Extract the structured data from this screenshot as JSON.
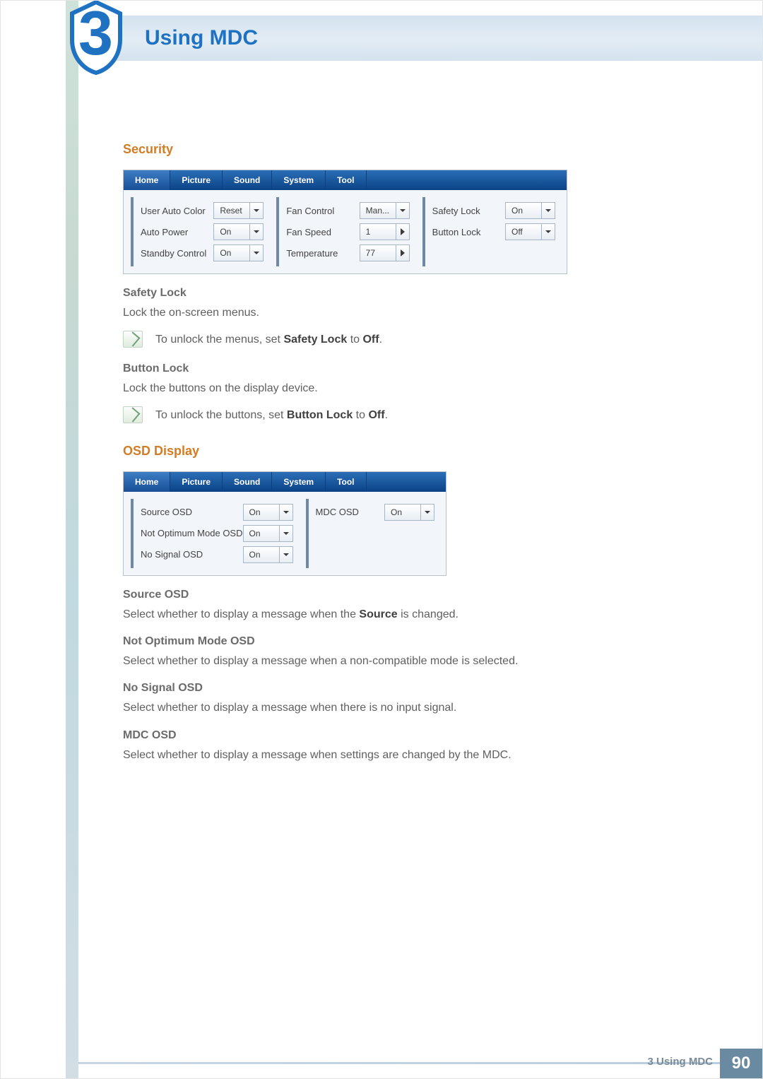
{
  "chapter": {
    "number": "3",
    "title": "Using MDC"
  },
  "sections": {
    "security": {
      "heading": "Security",
      "panel": {
        "tabs": [
          "Home",
          "Picture",
          "Sound",
          "System",
          "Tool"
        ],
        "groups": [
          {
            "rows": [
              {
                "label": "User Auto Color",
                "value": "Reset",
                "style": "dropdown"
              },
              {
                "label": "Auto Power",
                "value": "On",
                "style": "dropdown"
              },
              {
                "label": "Standby Control",
                "value": "On",
                "style": "dropdown"
              }
            ]
          },
          {
            "rows": [
              {
                "label": "Fan Control",
                "value": "Man...",
                "style": "dropdown"
              },
              {
                "label": "Fan Speed",
                "value": "1",
                "style": "spinner"
              },
              {
                "label": "Temperature",
                "value": "77",
                "style": "spinner"
              }
            ]
          },
          {
            "rows": [
              {
                "label": "Safety Lock",
                "value": "On",
                "style": "dropdown"
              },
              {
                "label": "Button Lock",
                "value": "Off",
                "style": "dropdown"
              }
            ]
          }
        ]
      },
      "safety_lock": {
        "heading": "Safety Lock",
        "desc": "Lock the on-screen menus.",
        "note_pre": "To unlock the menus, set ",
        "note_b1": "Safety Lock",
        "note_mid": " to ",
        "note_b2": "Off",
        "note_post": "."
      },
      "button_lock": {
        "heading": "Button Lock",
        "desc": "Lock the buttons on the display device.",
        "note_pre": "To unlock the buttons, set ",
        "note_b1": "Button Lock",
        "note_mid": " to ",
        "note_b2": "Off",
        "note_post": "."
      }
    },
    "osd": {
      "heading": "OSD Display",
      "panel": {
        "tabs": [
          "Home",
          "Picture",
          "Sound",
          "System",
          "Tool"
        ],
        "left_rows": [
          {
            "label": "Source OSD",
            "value": "On"
          },
          {
            "label": "Not Optimum Mode OSD",
            "value": "On"
          },
          {
            "label": "No Signal OSD",
            "value": "On"
          }
        ],
        "right_rows": [
          {
            "label": "MDC OSD",
            "value": "On"
          }
        ]
      },
      "items": {
        "source": {
          "heading": "Source OSD",
          "pre": "Select whether to display a message when the ",
          "b": "Source",
          "post": " is changed."
        },
        "not_opt": {
          "heading": "Not Optimum Mode OSD",
          "desc": "Select whether to display a message when a non-compatible mode is selected."
        },
        "no_signal": {
          "heading": "No Signal OSD",
          "desc": "Select whether to display a message when there is no input signal."
        },
        "mdc": {
          "heading": "MDC OSD",
          "desc": "Select whether to display a message when settings are changed by the MDC."
        }
      }
    }
  },
  "footer": {
    "text": "3 Using MDC",
    "page": "90"
  }
}
